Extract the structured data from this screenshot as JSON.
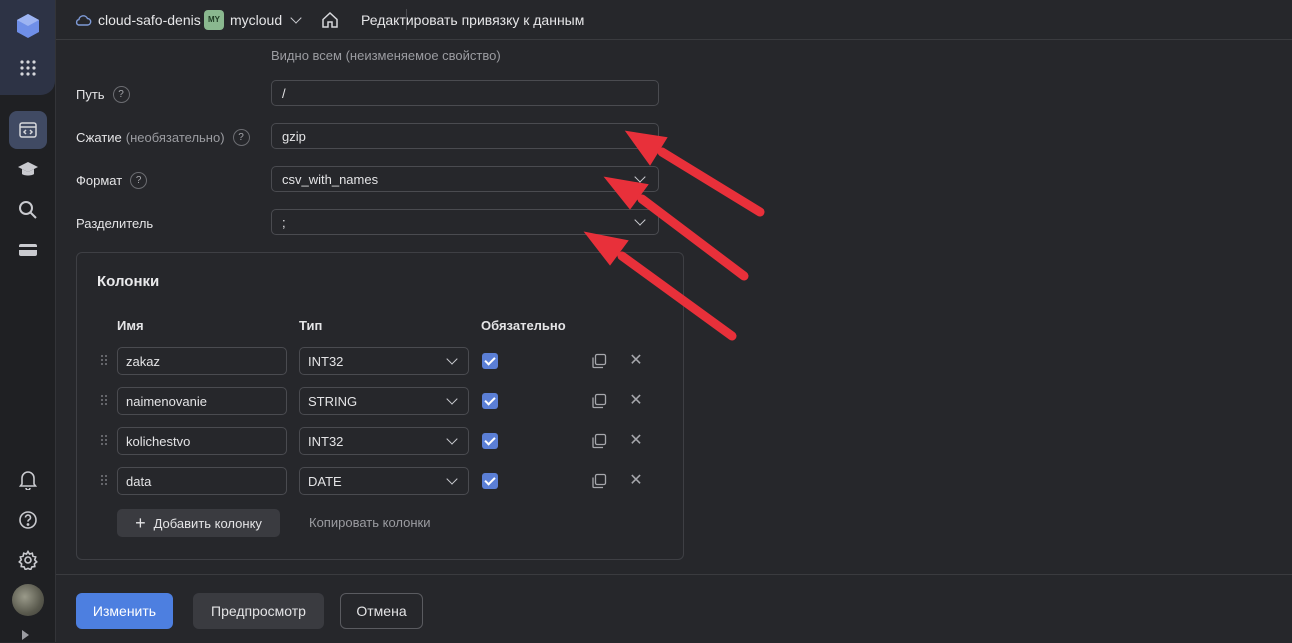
{
  "topbar": {
    "cloud_name": "cloud-safo-denis",
    "folder_badge": "MY",
    "folder_name": "mycloud",
    "page_title": "Редактировать привязку к данным"
  },
  "form": {
    "visibility_hint": "Видно всем (неизменяемое свойство)",
    "path": {
      "label": "Путь",
      "help": "?",
      "value": "/"
    },
    "compression": {
      "label": "Сжатие",
      "label_optional": "(необязательно)",
      "help": "?",
      "value": "gzip"
    },
    "format": {
      "label": "Формат",
      "help": "?",
      "value": "csv_with_names"
    },
    "delimiter": {
      "label": "Разделитель",
      "value": ";"
    }
  },
  "columns": {
    "title": "Колонки",
    "headers": {
      "name": "Имя",
      "type": "Тип",
      "required": "Обязательно"
    },
    "rows": [
      {
        "name": "zakaz",
        "type": "INT32",
        "required": true
      },
      {
        "name": "naimenovanie",
        "type": "STRING",
        "required": true
      },
      {
        "name": "kolichestvo",
        "type": "INT32",
        "required": true
      },
      {
        "name": "data",
        "type": "DATE",
        "required": true
      }
    ],
    "add_label": "Добавить колонку",
    "copy_label": "Копировать колонки"
  },
  "footer": {
    "submit_label": "Изменить",
    "preview_label": "Предпросмотр",
    "cancel_label": "Отмена"
  },
  "colors": {
    "primary": "#4d7fe0",
    "checkbox": "#5b7fd6",
    "annotation_arrow": "#e8303a"
  },
  "icons": {
    "rail": [
      "logo-icon",
      "apps-grid-icon",
      "console-icon",
      "education-icon",
      "search-icon",
      "billing-icon",
      "bell-icon",
      "help-icon",
      "settings-icon",
      "avatar"
    ]
  }
}
